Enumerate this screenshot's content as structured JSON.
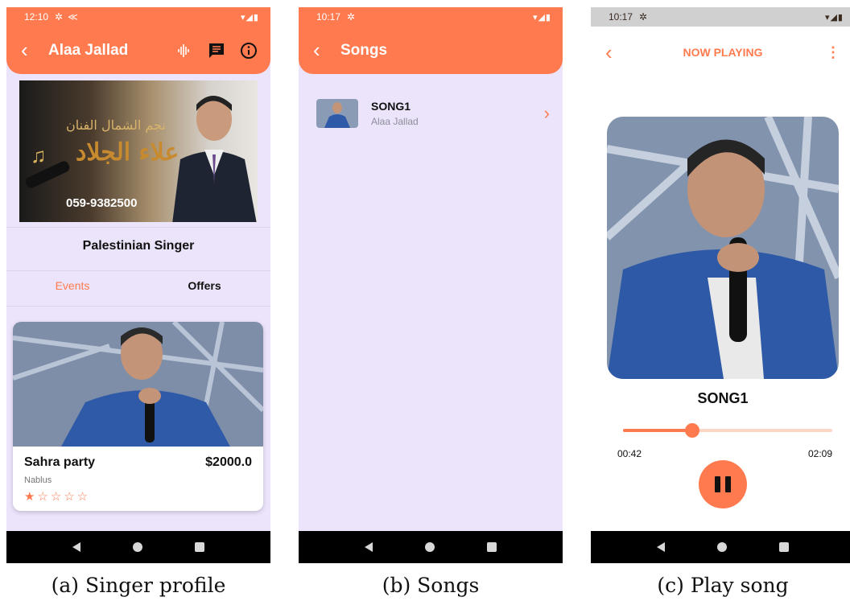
{
  "profile": {
    "status_time": "12:10",
    "status_icons": "▾◢▮",
    "title": "Alaa Jallad",
    "banner_arabic_top": "نجم الشمال الفنان",
    "banner_arabic_name": "علاء الجلاد",
    "banner_phone": "059-9382500",
    "subtitle": "Palestinian Singer",
    "tabs": [
      {
        "label": "Events",
        "active": true
      },
      {
        "label": "Offers",
        "active": false
      }
    ],
    "event": {
      "title": "Sahra party",
      "price": "$2000.0",
      "location": "Nablus",
      "rating": 1,
      "stars": "★☆☆☆☆"
    },
    "caption": "(a) Singer profile"
  },
  "songs": {
    "status_time": "10:17",
    "status_icons": "▾◢▮",
    "title": "Songs",
    "items": [
      {
        "name": "SONG1",
        "artist": "Alaa Jallad"
      }
    ],
    "caption": "(b) Songs"
  },
  "player": {
    "status_time": "10:17",
    "status_icons": "▾◢▮",
    "header": "NOW PLAYING",
    "song": "SONG1",
    "current_time": "00:42",
    "total_time": "02:09",
    "progress": 0.33,
    "caption": "(c) Play song"
  },
  "colors": {
    "accent": "#ff7b4f",
    "background": "#ece4fb"
  }
}
